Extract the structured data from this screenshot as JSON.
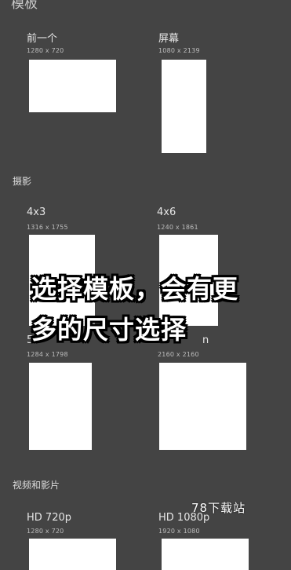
{
  "page": {
    "title": "模板"
  },
  "sections": [
    {
      "label": "",
      "templates": [
        {
          "name": "前一个",
          "size": "1280 x 720"
        },
        {
          "name": "屏幕",
          "size": "1080 x 2139"
        }
      ]
    },
    {
      "label": "摄影",
      "templates": [
        {
          "name": "4x3",
          "size": "1316 x 1755"
        },
        {
          "name": "4x6",
          "size": "1240 x 1861"
        },
        {
          "name": "5x",
          "size": "1284 x 1798"
        },
        {
          "name": "n",
          "size": "2160 x 2160"
        }
      ]
    },
    {
      "label": "视频和影片",
      "templates": [
        {
          "name": "HD 720p",
          "size": "1280 x 720"
        },
        {
          "name": "HD 1080p",
          "size": "1920 x 1080"
        }
      ]
    }
  ],
  "overlay": {
    "line1": "选择模板，会有更",
    "line2": "多的尺寸选择"
  },
  "watermark": "78下载站"
}
